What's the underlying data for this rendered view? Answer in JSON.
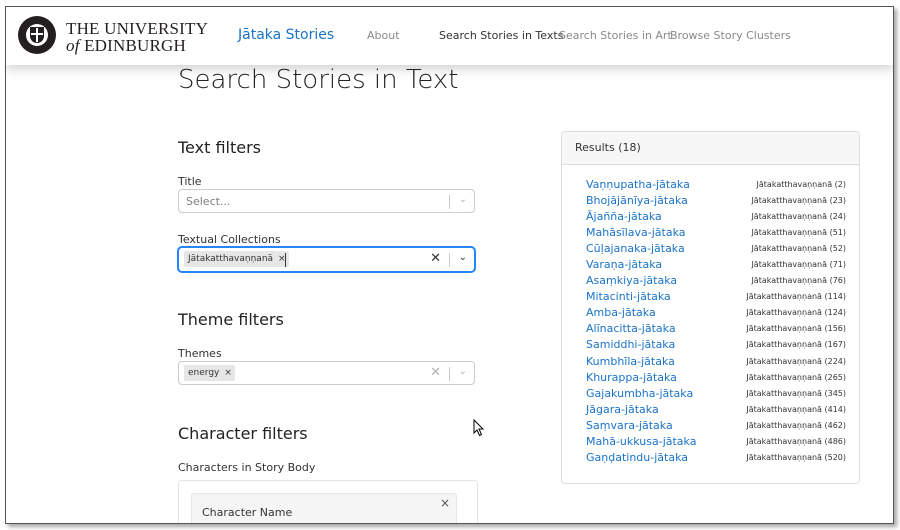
{
  "logo": {
    "line1": "THE UNIVERSITY",
    "line2_of": "of",
    "line2_rest": " EDINBURGH"
  },
  "nav": {
    "brand": "Jātaka Stories",
    "links": [
      "About",
      "Search Stories in Texts",
      "Search Stories in Art",
      "Browse Story Clusters"
    ],
    "active": "Search Stories in Texts"
  },
  "page": {
    "title": "Search Stories in Text"
  },
  "text_filters": {
    "heading": "Text filters",
    "title_label": "Title",
    "title_placeholder": "Select...",
    "collections_label": "Textual Collections",
    "collections_chip": "Jātakatthavaṇṇanā",
    "chip_remove": "×"
  },
  "theme_filters": {
    "heading": "Theme filters",
    "themes_label": "Themes",
    "themes_chip": "energy",
    "chip_remove": "×"
  },
  "character_filters": {
    "heading": "Character filters",
    "body_label": "Characters in Story Body",
    "card_label": "Character Name",
    "card_close": "×"
  },
  "results": {
    "header": "Results (18)",
    "items": [
      {
        "title": "Vaṇṇupatha-jātaka",
        "collection": "Jātakatthavaṇṇanā (2)"
      },
      {
        "title": "Bhojājānīya-jātaka",
        "collection": "Jātakatthavaṇṇanā (23)"
      },
      {
        "title": "Ājañña-jātaka",
        "collection": "Jātakatthavaṇṇanā (24)"
      },
      {
        "title": "Mahāsīlava-jātaka",
        "collection": "Jātakatthavaṇṇanā (51)"
      },
      {
        "title": "Cūḷajanaka-jātaka",
        "collection": "Jātakatthavaṇṇanā (52)"
      },
      {
        "title": "Varaṇa-jātaka",
        "collection": "Jātakatthavaṇṇanā (71)"
      },
      {
        "title": "Asaṃkiya-jātaka",
        "collection": "Jātakatthavaṇṇanā (76)"
      },
      {
        "title": "Mitacinti-jātaka",
        "collection": "Jātakatthavaṇṇanā (114)"
      },
      {
        "title": "Amba-jātaka",
        "collection": "Jātakatthavaṇṇanā (124)"
      },
      {
        "title": "Alīnacitta-jātaka",
        "collection": "Jātakatthavaṇṇanā (156)"
      },
      {
        "title": "Samiddhi-jātaka",
        "collection": "Jātakatthavaṇṇanā (167)"
      },
      {
        "title": "Kumbhīla-jātaka",
        "collection": "Jātakatthavaṇṇanā (224)"
      },
      {
        "title": "Khurappa-jātaka",
        "collection": "Jātakatthavaṇṇanā (265)"
      },
      {
        "title": "Gajakumbha-jātaka",
        "collection": "Jātakatthavaṇṇanā (345)"
      },
      {
        "title": "Jāgara-jātaka",
        "collection": "Jātakatthavaṇṇanā (414)"
      },
      {
        "title": "Saṃvara-jātaka",
        "collection": "Jātakatthavaṇṇanā (462)"
      },
      {
        "title": "Mahā-ukkusa-jātaka",
        "collection": "Jātakatthavaṇṇanā (486)"
      },
      {
        "title": "Gaṇḍatindu-jātaka",
        "collection": "Jātakatthavaṇṇanā (520)"
      }
    ]
  }
}
